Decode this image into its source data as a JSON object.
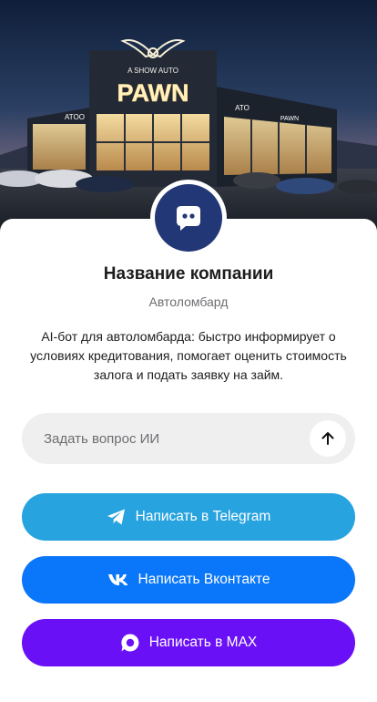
{
  "hero": {
    "sign_top": "A SHOW AUTO",
    "sign_main": "PAWN",
    "window_left": "ATOO",
    "window_mid": "ATO",
    "window_right": "PAWN"
  },
  "profile": {
    "avatar_icon": "chat-bubble-icon",
    "name": "Название компании",
    "category": "Автоломбард",
    "description": "AI-бот для автоломбарда: быстро информирует о условиях кредитования, помогает оценить стоимость залога и подать заявку на займ."
  },
  "ask": {
    "placeholder": "Задать вопрос ИИ",
    "value": "",
    "send_icon": "arrow-up-icon"
  },
  "buttons": {
    "telegram": {
      "label": "Написать в Telegram",
      "icon": "telegram-icon",
      "color": "#27a3e0"
    },
    "vk": {
      "label": "Написать Вконтакте",
      "icon": "vk-icon",
      "color": "#0a77fa"
    },
    "max": {
      "label": "Написать в MAX",
      "icon": "max-icon",
      "color": "#6a10f6"
    }
  },
  "colors": {
    "avatar_bg": "#223775",
    "input_bg": "#efefef"
  }
}
